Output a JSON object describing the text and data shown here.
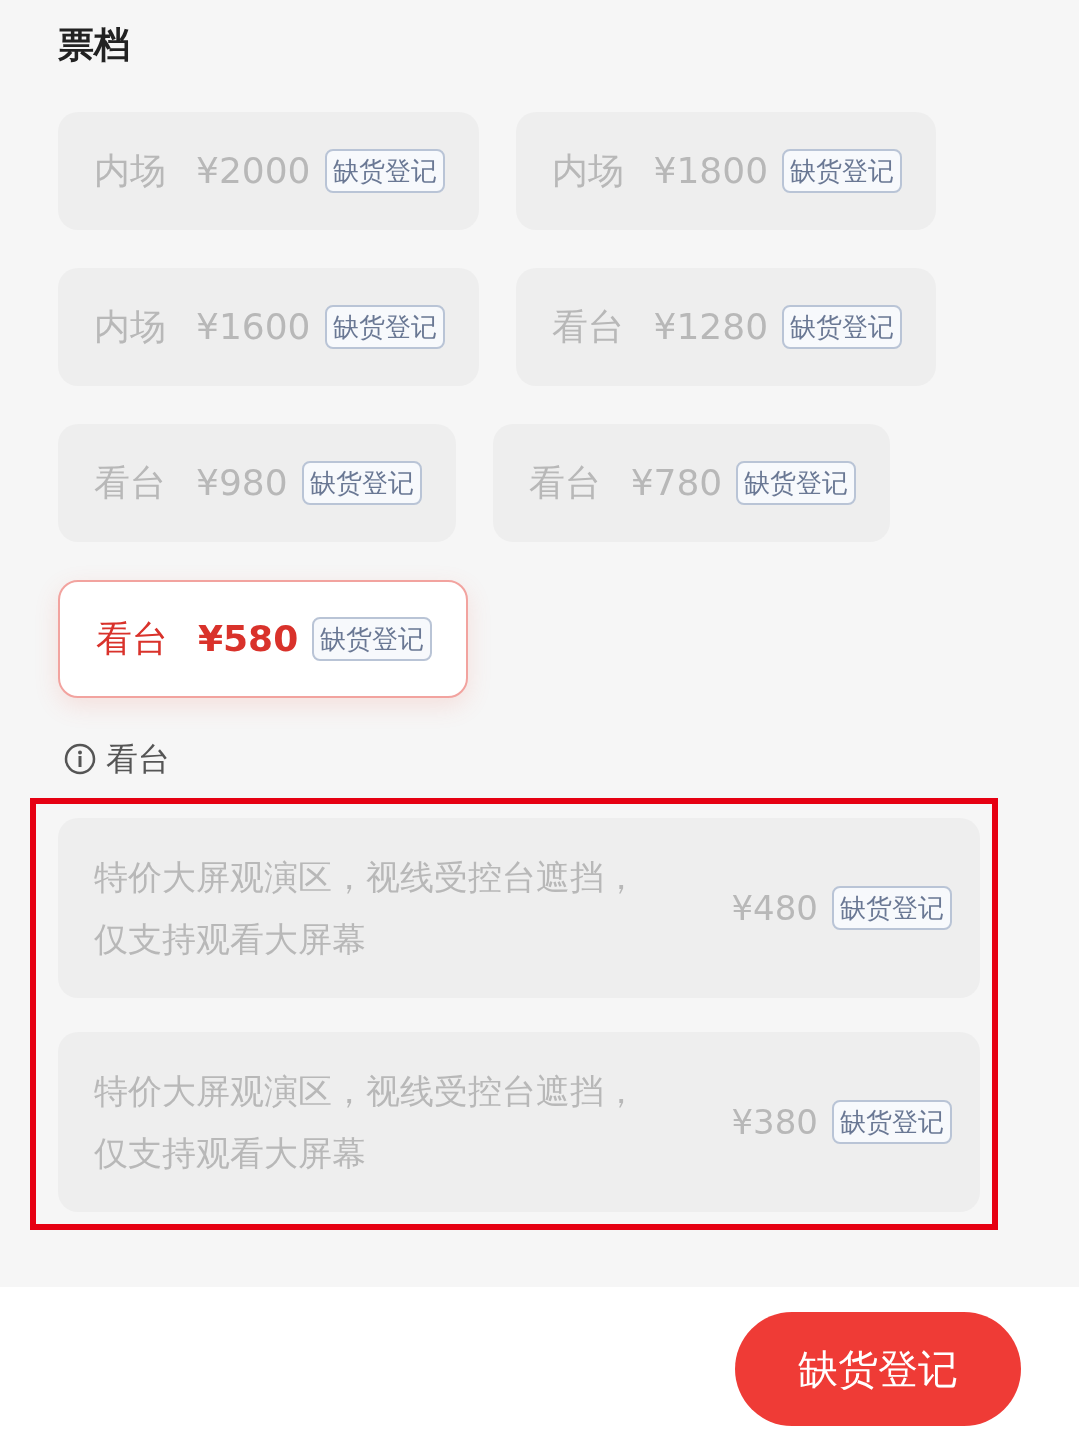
{
  "title": "票档",
  "tiers": [
    {
      "area": "内场",
      "price": "¥2000",
      "badge": "缺货登记",
      "selected": false
    },
    {
      "area": "内场",
      "price": "¥1800",
      "badge": "缺货登记",
      "selected": false
    },
    {
      "area": "内场",
      "price": "¥1600",
      "badge": "缺货登记",
      "selected": false
    },
    {
      "area": "看台",
      "price": "¥1280",
      "badge": "缺货登记",
      "selected": false
    },
    {
      "area": "看台",
      "price": "¥980",
      "badge": "缺货登记",
      "selected": false
    },
    {
      "area": "看台",
      "price": "¥780",
      "badge": "缺货登记",
      "selected": false
    },
    {
      "area": "看台",
      "price": "¥580",
      "badge": "缺货登记",
      "selected": true
    }
  ],
  "note": "看台",
  "special_tiers": [
    {
      "description": "特价大屏观演区，视线受控台遮挡，仅支持观看大屏幕",
      "price": "¥480",
      "badge": "缺货登记"
    },
    {
      "description": "特价大屏观演区，视线受控台遮挡，仅支持观看大屏幕",
      "price": "¥380",
      "badge": "缺货登记"
    }
  ],
  "action_button": "缺货登记"
}
